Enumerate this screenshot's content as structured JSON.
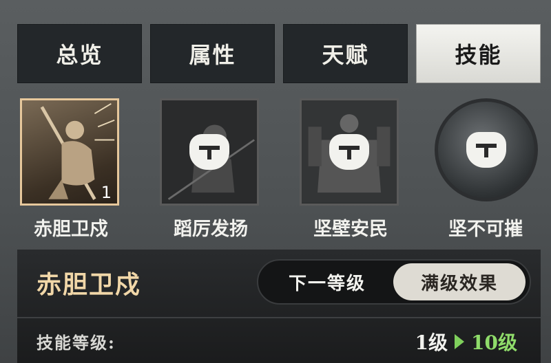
{
  "tabs": [
    {
      "label": "总览",
      "active": false
    },
    {
      "label": "属性",
      "active": false
    },
    {
      "label": "天赋",
      "active": false
    },
    {
      "label": "技能",
      "active": true
    }
  ],
  "skills": [
    {
      "name": "赤胆卫戍",
      "level": "1",
      "selected": true,
      "locked": false,
      "icon": "spear-warrior-icon"
    },
    {
      "name": "蹈厉发扬",
      "selected": false,
      "locked": true,
      "icon": "lock-icon"
    },
    {
      "name": "坚壁安民",
      "selected": false,
      "locked": true,
      "icon": "lock-icon"
    },
    {
      "name": "坚不可摧",
      "selected": false,
      "locked": true,
      "icon": "lock-icon"
    }
  ],
  "detail": {
    "title": "赤胆卫戍",
    "toggle": {
      "next_label": "下一等级",
      "max_label": "满级效果",
      "selected": "max"
    },
    "level_label": "技能等级:",
    "level_from": "1级",
    "level_to": "10级"
  },
  "colors": {
    "accent_gold": "#f1d7a8",
    "accent_green": "#8fdc6a",
    "tab_active_bg": "#e8e8e4"
  }
}
